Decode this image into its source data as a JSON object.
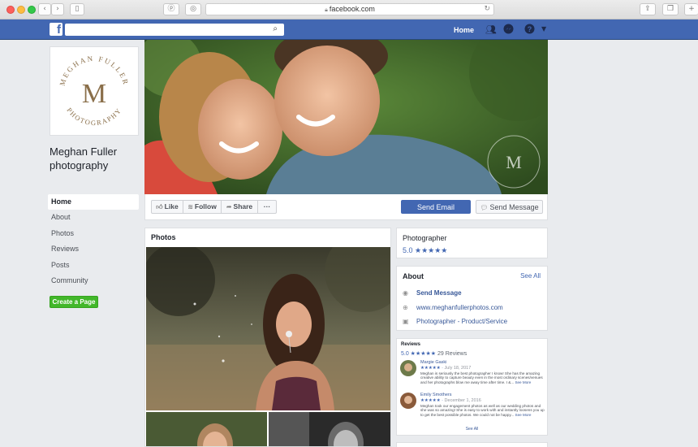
{
  "browser": {
    "url": "facebook.com"
  },
  "topbar": {
    "logo": "f",
    "search_placeholder": "",
    "home": "Home"
  },
  "profile": {
    "logo_top": "MEGHAN FULLER",
    "logo_bottom": "PHOTOGRAPHY",
    "logo_mark": "M",
    "name": "Meghan Fuller photography"
  },
  "left_nav": {
    "items": [
      "Home",
      "About",
      "Photos",
      "Reviews",
      "Posts",
      "Community"
    ],
    "create_page": "Create a Page"
  },
  "actions": {
    "like": "Like",
    "follow": "Follow",
    "share": "Share",
    "more": "···",
    "send_email": "Send Email",
    "send_message": "Send Message"
  },
  "photos": {
    "title": "Photos"
  },
  "category_card": {
    "category": "Photographer",
    "rating_text": "5.0 ★★★★★"
  },
  "about": {
    "title": "About",
    "see_all": "See All",
    "rows": [
      {
        "icon": "messenger-icon",
        "text": "Send Message"
      },
      {
        "icon": "globe-icon",
        "text": "www.meghanfullerphotos.com"
      },
      {
        "icon": "briefcase-icon",
        "text": "Photographer - Product/Service"
      }
    ]
  },
  "reviews": {
    "title": "Reviews",
    "rating": "5.0 ★★★★★",
    "count": "29 Reviews",
    "items": [
      {
        "name": "Margie Gaski",
        "stars": "★★★★★",
        "date": "July 18, 2017",
        "text": "Meghan is seriously the best photographer I know! She has the amazing creative ability to capture beauty even in the most ordinary scenes/venues and her photographs blow me away time after time. I &...",
        "more": "See More"
      },
      {
        "name": "Emily Smothers",
        "stars": "★★★★★",
        "date": "December 1, 2016",
        "text": "Meghan took our engagement photos as well as our wedding photos and she was so amazing! She is easy to work with and instantly loosens you up to get the best possible photos. We could not be happy...",
        "more": "See More"
      }
    ],
    "see_all": "See All"
  },
  "colors": {
    "fb_blue": "#4267b2",
    "green": "#42b72a",
    "page_bg": "#e9ebee"
  }
}
